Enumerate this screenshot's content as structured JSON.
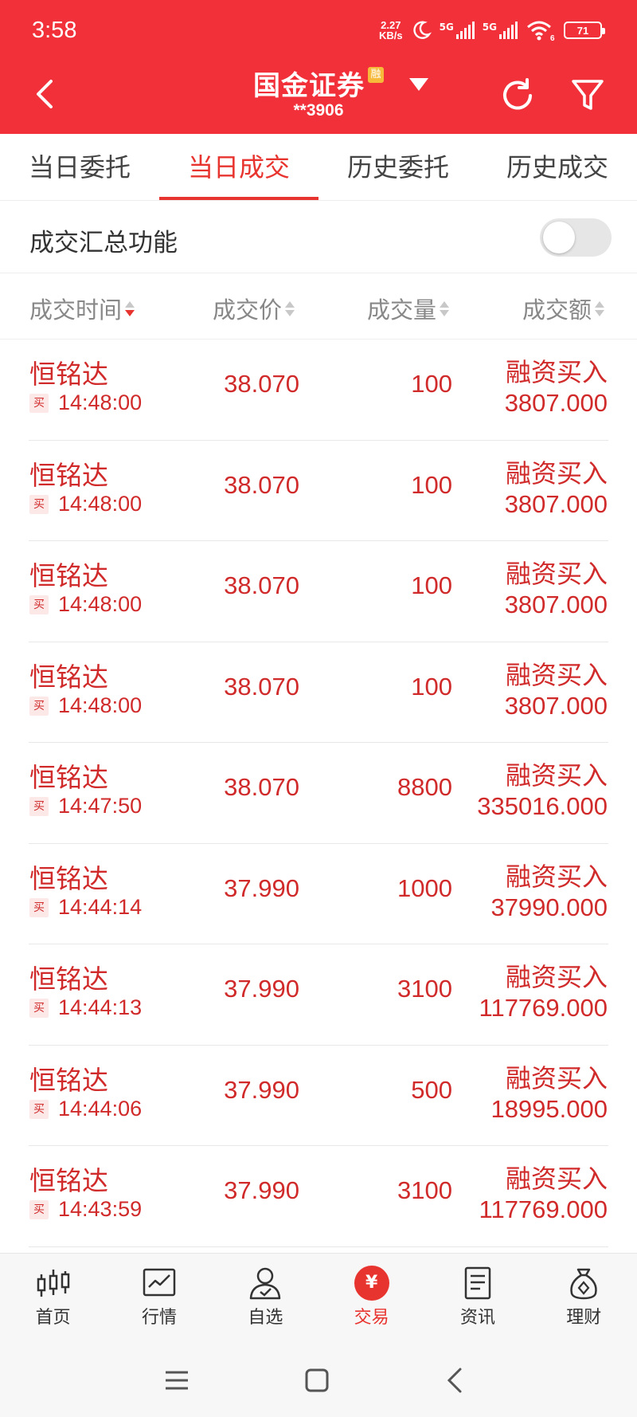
{
  "status_bar": {
    "time": "3:58",
    "net_speed_value": "2.27",
    "net_speed_unit": "KB/s",
    "sim1": "5G",
    "sim2": "5G",
    "wifi_sub": "6",
    "battery": "71"
  },
  "header": {
    "title": "国金证券",
    "title_badge": "融",
    "account": "**3906",
    "icons": [
      "back-icon",
      "dropdown-caret-icon",
      "refresh-icon",
      "filter-icon"
    ],
    "background_color": "#f2303a"
  },
  "tabs": [
    {
      "label": "当日委托",
      "active": false
    },
    {
      "label": "当日成交",
      "active": true
    },
    {
      "label": "历史委托",
      "active": false
    },
    {
      "label": "历史成交",
      "active": false
    }
  ],
  "summary": {
    "label": "成交汇总功能",
    "enabled": false
  },
  "columns": [
    {
      "label": "成交时间",
      "sort": "desc"
    },
    {
      "label": "成交价",
      "sort": "none"
    },
    {
      "label": "成交量",
      "sort": "none"
    },
    {
      "label": "成交额",
      "sort": "none"
    }
  ],
  "rows": [
    {
      "name": "恒铭达",
      "side": "买",
      "time": "14:48:00",
      "price": "38.070",
      "qty": "100",
      "type": "融资买入",
      "amount": "3807.000"
    },
    {
      "name": "恒铭达",
      "side": "买",
      "time": "14:48:00",
      "price": "38.070",
      "qty": "100",
      "type": "融资买入",
      "amount": "3807.000"
    },
    {
      "name": "恒铭达",
      "side": "买",
      "time": "14:48:00",
      "price": "38.070",
      "qty": "100",
      "type": "融资买入",
      "amount": "3807.000"
    },
    {
      "name": "恒铭达",
      "side": "买",
      "time": "14:48:00",
      "price": "38.070",
      "qty": "100",
      "type": "融资买入",
      "amount": "3807.000"
    },
    {
      "name": "恒铭达",
      "side": "买",
      "time": "14:47:50",
      "price": "38.070",
      "qty": "8800",
      "type": "融资买入",
      "amount": "335016.000"
    },
    {
      "name": "恒铭达",
      "side": "买",
      "time": "14:44:14",
      "price": "37.990",
      "qty": "1000",
      "type": "融资买入",
      "amount": "37990.000"
    },
    {
      "name": "恒铭达",
      "side": "买",
      "time": "14:44:13",
      "price": "37.990",
      "qty": "3100",
      "type": "融资买入",
      "amount": "117769.000"
    },
    {
      "name": "恒铭达",
      "side": "买",
      "time": "14:44:06",
      "price": "37.990",
      "qty": "500",
      "type": "融资买入",
      "amount": "18995.000"
    },
    {
      "name": "恒铭达",
      "side": "买",
      "time": "14:43:59",
      "price": "37.990",
      "qty": "3100",
      "type": "融资买入",
      "amount": "117769.000"
    }
  ],
  "bottom_nav": [
    {
      "label": "首页",
      "icon": "candlestick-icon",
      "active": false
    },
    {
      "label": "行情",
      "icon": "trend-chart-icon",
      "active": false
    },
    {
      "label": "自选",
      "icon": "person-check-icon",
      "active": false
    },
    {
      "label": "交易",
      "icon": "yuan-icon",
      "glyph": "¥",
      "active": true
    },
    {
      "label": "资讯",
      "icon": "document-icon",
      "active": false
    },
    {
      "label": "理财",
      "icon": "money-bag-icon",
      "active": false
    }
  ],
  "colors": {
    "accent": "#e8342f",
    "value_red": "#d02a2a",
    "header_red": "#f2303a"
  }
}
